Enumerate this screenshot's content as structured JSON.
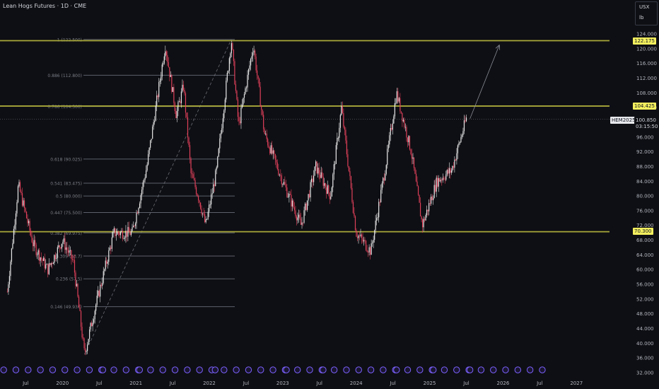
{
  "header": {
    "title": "Lean Hogs Futures · 1D · CME"
  },
  "unit_box": {
    "currency": "USX",
    "unit": "lb"
  },
  "price_badges": {
    "level_top": "122.175",
    "level_mid": "104.425",
    "level_low": "70.300",
    "symbol": "HEM2025",
    "last_price": "100.850",
    "countdown": "03:15:50"
  },
  "colors": {
    "background": "#0e0f14",
    "level_line": "#a8a83a",
    "fib_line": "#5d606b",
    "candle_up": "#e8e8e8",
    "candle_down": "#e0405a",
    "event_icon": "#7b61ff",
    "highlight_badge": "#f3ef5e"
  },
  "chart_data": {
    "type": "candlestick",
    "title": "Lean Hogs Futures · 1D · CME",
    "x_ticks": [
      "Jul",
      "2020",
      "Jul",
      "2021",
      "Jul",
      "2022",
      "Jul",
      "2023",
      "Jul",
      "2024",
      "Jul",
      "2025",
      "Jul",
      "2026",
      "Jul",
      "2027"
    ],
    "y_ticks": [
      "124.000",
      "120.000",
      "116.000",
      "112.000",
      "108.000",
      "104.000",
      "100.000",
      "96.000",
      "92.000",
      "88.000",
      "84.000",
      "80.000",
      "76.000",
      "72.000",
      "68.000",
      "64.000",
      "60.000",
      "56.000",
      "52.000",
      "48.000",
      "44.000",
      "40.000",
      "36.000",
      "32.000"
    ],
    "y_range": [
      32,
      124
    ],
    "horizontal_levels": [
      122.175,
      104.425,
      70.3
    ],
    "fib_levels": [
      {
        "label": "1 (122.500)",
        "value": 122.5
      },
      {
        "label": "0.886 (112.800)",
        "value": 112.8
      },
      {
        "label": "0.786 (104.300)",
        "value": 104.3
      },
      {
        "label": "0.618 (90.025)",
        "value": 90.025
      },
      {
        "label": "0.541 (83.475)",
        "value": 83.475
      },
      {
        "label": "0.5 (80.000)",
        "value": 80.0
      },
      {
        "label": "0.447 (75.500)",
        "value": 75.5
      },
      {
        "label": "0.382 (69.975)",
        "value": 69.975
      },
      {
        "label": "0.309 (63.7)",
        "value": 63.7
      },
      {
        "label": "0.236 (57.5)",
        "value": 57.5
      },
      {
        "label": "0.146 (49.930)",
        "value": 49.93
      }
    ],
    "price_path": [
      {
        "t": 2019.25,
        "p": 54
      },
      {
        "t": 2019.4,
        "p": 83
      },
      {
        "t": 2019.6,
        "p": 67
      },
      {
        "t": 2019.8,
        "p": 60
      },
      {
        "t": 2020.0,
        "p": 68
      },
      {
        "t": 2020.15,
        "p": 62
      },
      {
        "t": 2020.3,
        "p": 37
      },
      {
        "t": 2020.45,
        "p": 50
      },
      {
        "t": 2020.7,
        "p": 70
      },
      {
        "t": 2020.95,
        "p": 70
      },
      {
        "t": 2021.15,
        "p": 88
      },
      {
        "t": 2021.4,
        "p": 121
      },
      {
        "t": 2021.55,
        "p": 102
      },
      {
        "t": 2021.65,
        "p": 110
      },
      {
        "t": 2021.75,
        "p": 86
      },
      {
        "t": 2021.85,
        "p": 80
      },
      {
        "t": 2021.95,
        "p": 72
      },
      {
        "t": 2022.1,
        "p": 87
      },
      {
        "t": 2022.3,
        "p": 122.5
      },
      {
        "t": 2022.4,
        "p": 99
      },
      {
        "t": 2022.6,
        "p": 121
      },
      {
        "t": 2022.75,
        "p": 97
      },
      {
        "t": 2023.0,
        "p": 84
      },
      {
        "t": 2023.25,
        "p": 72
      },
      {
        "t": 2023.45,
        "p": 88
      },
      {
        "t": 2023.65,
        "p": 80
      },
      {
        "t": 2023.8,
        "p": 104
      },
      {
        "t": 2024.0,
        "p": 70
      },
      {
        "t": 2024.2,
        "p": 65
      },
      {
        "t": 2024.4,
        "p": 88
      },
      {
        "t": 2024.55,
        "p": 108
      },
      {
        "t": 2024.75,
        "p": 92
      },
      {
        "t": 2024.9,
        "p": 72
      },
      {
        "t": 2025.1,
        "p": 84
      },
      {
        "t": 2025.3,
        "p": 87
      },
      {
        "t": 2025.5,
        "p": 101
      }
    ],
    "projection": {
      "from": [
        2025.55,
        101
      ],
      "to": [
        2025.95,
        121
      ]
    }
  }
}
